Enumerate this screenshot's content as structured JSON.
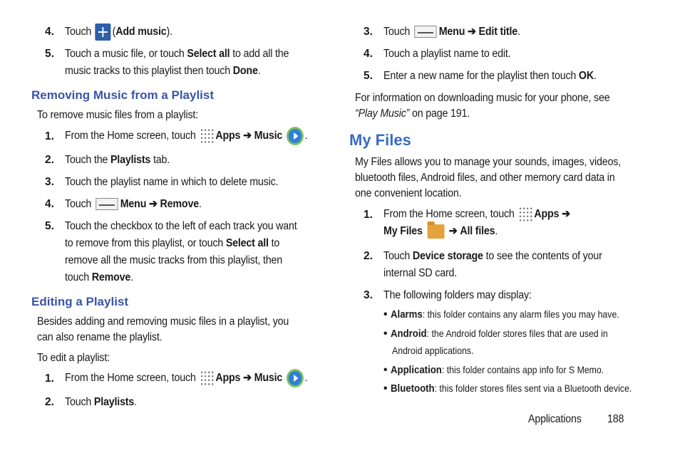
{
  "left": {
    "step4": {
      "num": "4.",
      "pre": "Touch",
      "bold": "Add music"
    },
    "step5": {
      "num": "5.",
      "line1_pre": "Touch a music file, or touch ",
      "line1_bold": "Select all",
      "line1_post": " to add all the",
      "line2_pre": "music tracks to this playlist then touch ",
      "line2_bold": "Done",
      "line2_post": "."
    },
    "remove_heading": "Removing Music from a Playlist",
    "remove_intro": "To remove music files from a playlist:",
    "r1": {
      "num": "1.",
      "pre": "From the Home screen, touch",
      "apps": "Apps",
      "arrow": "➔",
      "music": "Music"
    },
    "r2": {
      "num": "2.",
      "pre": "Touch the ",
      "bold": "Playlists",
      "post": " tab."
    },
    "r3": {
      "num": "3.",
      "text": "Touch the playlist name in which to delete music."
    },
    "r4": {
      "num": "4.",
      "pre": "Touch",
      "menu": "Menu",
      "arrow": "➔",
      "remove": "Remove"
    },
    "r5": {
      "num": "5.",
      "line1": "Touch the checkbox to the left of each track you want",
      "line2_pre": "to remove from this playlist, or touch ",
      "line2_bold": "Select all",
      "line2_post": " to",
      "line3": "remove all the music tracks from this playlist, then",
      "line4_pre": "touch ",
      "line4_bold": "Remove",
      "line4_post": "."
    },
    "edit_heading": "Editing a Playlist",
    "edit_intro1": "Besides adding and removing music files in a playlist, you",
    "edit_intro2": "can also rename the playlist.",
    "edit_intro3": "To edit a playlist:",
    "e1": {
      "num": "1.",
      "pre": "From the Home screen, touch",
      "apps": "Apps",
      "arrow": "➔",
      "music": "Music"
    },
    "e2": {
      "num": "2.",
      "pre": "Touch ",
      "bold": "Playlists",
      "post": "."
    }
  },
  "right": {
    "s3": {
      "num": "3.",
      "pre": "Touch",
      "menu": "Menu",
      "arrow": "➔",
      "bold": "Edit title"
    },
    "s4": {
      "num": "4.",
      "text": "Touch a playlist name to edit."
    },
    "s5": {
      "num": "5.",
      "pre": "Enter a new name for the playlist then touch ",
      "bold": "OK",
      "post": "."
    },
    "info1": "For information on downloading music for your phone, see",
    "info2_italic": "“Play Music”",
    "info2_post": " on page 191.",
    "myfiles_heading": "My Files",
    "myfiles_p1": "My Files allows you to manage your sounds, images, videos,",
    "myfiles_p2": "bluetooth files, Android files, and other memory card data in",
    "myfiles_p3": "one convenient location.",
    "m1": {
      "num": "1.",
      "pre": "From the Home screen, touch",
      "apps": "Apps",
      "arrow": "➔",
      "myfiles": "My Files",
      "arrow2": "➔",
      "allfiles": "All files"
    },
    "m2": {
      "num": "2.",
      "pre": "Touch ",
      "bold": "Device storage",
      "post": " to see the contents of your",
      "line2": "internal SD card."
    },
    "m3": {
      "num": "3.",
      "text": "The following folders may display:"
    },
    "bullets": [
      {
        "label": "Alarms",
        "text": ": this folder contains any alarm files you may have."
      },
      {
        "label": "Android",
        "text": ": the Android folder stores files that are used in",
        "line2": "Android applications."
      },
      {
        "label": "Application",
        "text": ": this folder contains app info for S Memo."
      },
      {
        "label": "Bluetooth",
        "text": ": this folder stores files sent via a Bluetooth device."
      }
    ],
    "bullet_char": "•"
  },
  "footer": {
    "section": "Applications",
    "page": "188"
  },
  "colors": {
    "heading_small": "#3a55a8",
    "heading_large": "#3a6cc0"
  }
}
